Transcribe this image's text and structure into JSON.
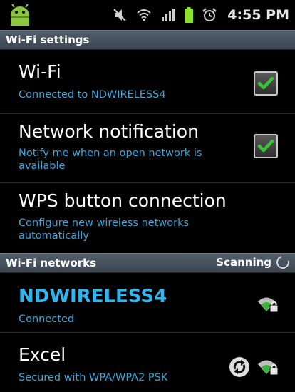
{
  "status_bar": {
    "time": "4:55 PM",
    "icons": [
      "android-icon",
      "mute-icon",
      "wifi-icon",
      "signal-icon",
      "battery-icon",
      "alarm-icon"
    ]
  },
  "wifi_settings": {
    "header": "Wi-Fi settings",
    "items": [
      {
        "title": "Wi-Fi",
        "summary": "Connected to NDWIRELESS4",
        "checked": true
      },
      {
        "title": "Network notification",
        "summary": "Notify me when an open network is available",
        "checked": true
      },
      {
        "title": "WPS button connection",
        "summary": "Configure new wireless networks automatically"
      }
    ]
  },
  "wifi_networks": {
    "header": "Wi-Fi networks",
    "status": "Scanning",
    "networks": [
      {
        "name": "NDWIRELESS4",
        "status": "Connected",
        "secured": true
      },
      {
        "name": "Excel",
        "status": "Secured with WPA/WPA2 PSK",
        "secured": true
      }
    ]
  },
  "colors": {
    "accent_text": "#3ea7d8",
    "network_name": "#2fb5f0",
    "check_green": "#39c23a",
    "header_bg": "#465360"
  }
}
